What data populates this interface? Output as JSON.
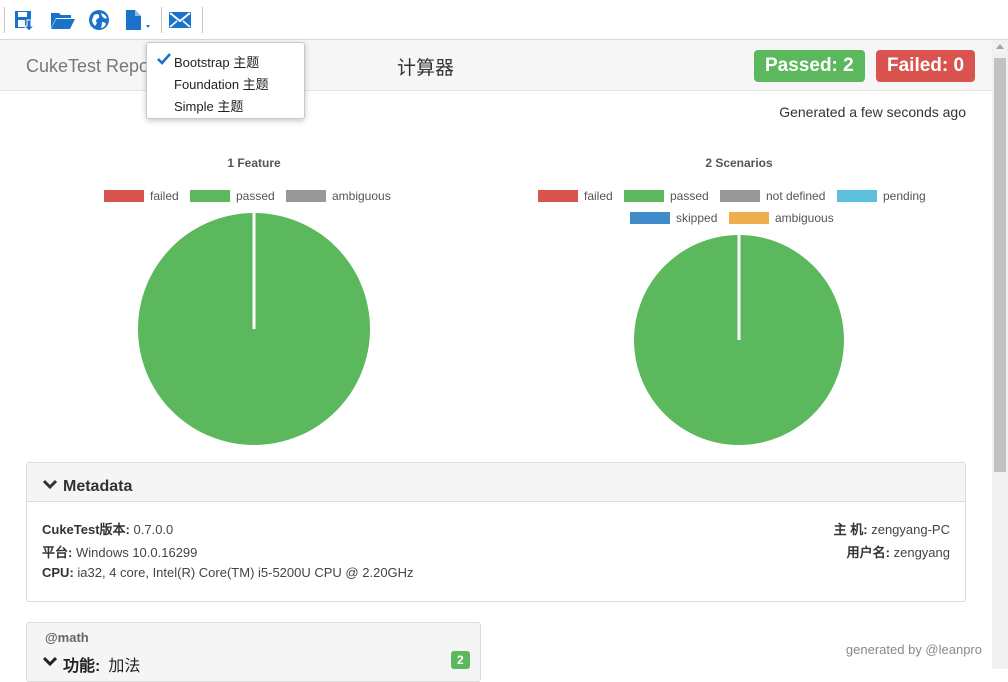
{
  "toolbar": {
    "buttons": [
      {
        "icon": "save-icon"
      },
      {
        "icon": "open-folder-icon"
      },
      {
        "icon": "globe-icon"
      },
      {
        "icon": "document-theme-icon"
      },
      {
        "icon": "mail-icon"
      }
    ]
  },
  "theme_menu": {
    "items": [
      {
        "label": "Bootstrap 主题",
        "checked": true
      },
      {
        "label": "Foundation 主题",
        "checked": false
      },
      {
        "label": "Simple 主题",
        "checked": false
      }
    ]
  },
  "header": {
    "brand": "CukeTest Repo",
    "title": "计算器",
    "passed_label": "Passed: 2",
    "failed_label": "Failed: 0"
  },
  "generated_text": "Generated a few seconds ago",
  "colors": {
    "failed": "#d9534f",
    "passed": "#5cb85c",
    "ambiguous": "#999999",
    "not_defined": "#999999",
    "pending": "#5bc0de",
    "skipped": "#428bca",
    "ambiguous2": "#f0ad4e"
  },
  "chart_data": [
    {
      "type": "pie",
      "title": "1 Feature",
      "categories": [
        "failed",
        "passed",
        "ambiguous"
      ],
      "values": [
        0,
        1,
        0
      ],
      "legend": "top"
    },
    {
      "type": "pie",
      "title": "2 Scenarios",
      "categories": [
        "failed",
        "passed",
        "not defined",
        "pending",
        "skipped",
        "ambiguous"
      ],
      "values": [
        0,
        2,
        0,
        0,
        0,
        0
      ],
      "legend": "top"
    }
  ],
  "metadata": {
    "heading": "Metadata",
    "left": [
      {
        "key": "CukeTest版本:",
        "value": "0.7.0.0"
      },
      {
        "key": "平台:",
        "value": "Windows 10.0.16299"
      },
      {
        "key": "CPU:",
        "value": "ia32, 4 core, Intel(R) Core(TM) i5-5200U CPU @ 2.20GHz"
      }
    ],
    "right": [
      {
        "key": "主 机:",
        "value": "zengyang-PC"
      },
      {
        "key": "用户名:",
        "value": "zengyang"
      }
    ]
  },
  "feature": {
    "tag": "@math",
    "keyword": "功能:",
    "name": "加法",
    "count": "2"
  },
  "footer": "generated by @leanpro"
}
